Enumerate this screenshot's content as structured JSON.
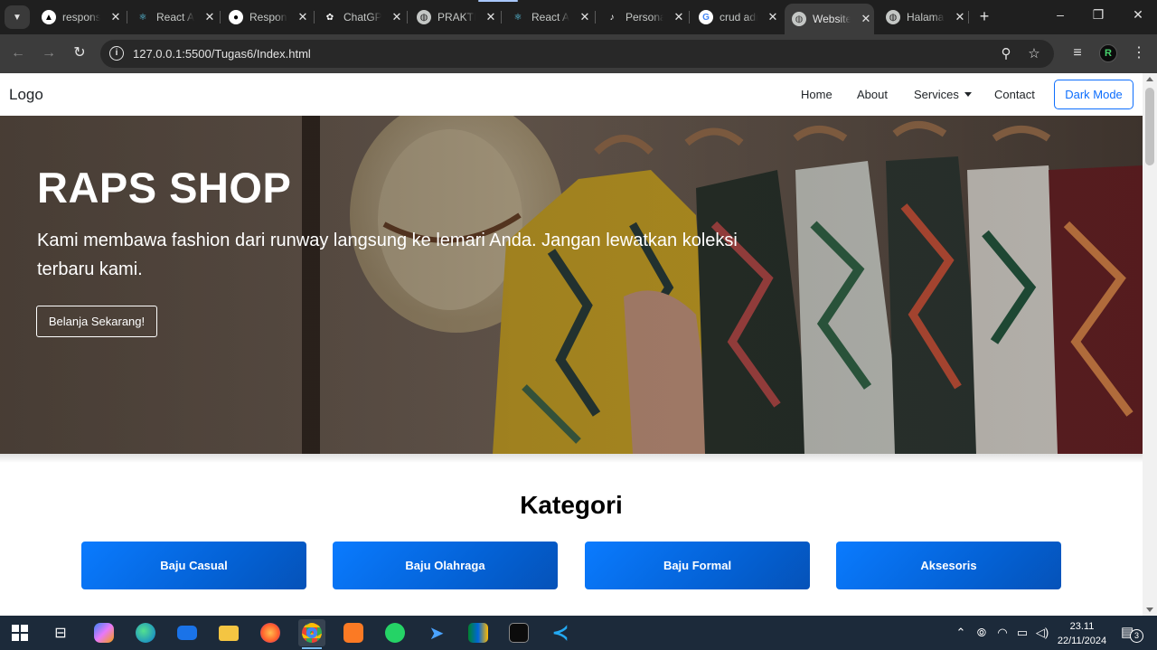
{
  "browser": {
    "tabs": [
      {
        "title": "responsive",
        "favicon": "vercel-icon",
        "favicon_color": "#000000"
      },
      {
        "title": "React App",
        "favicon": "react-icon",
        "favicon_color": "#61dafb"
      },
      {
        "title": "Responsive",
        "favicon": "github-icon",
        "favicon_color": "#ffffff"
      },
      {
        "title": "ChatGPT",
        "favicon": "chatgpt-icon",
        "favicon_color": "#ffffff"
      },
      {
        "title": "PRAKTIKUM",
        "favicon": "globe-icon",
        "favicon_color": "#c4c7c5"
      },
      {
        "title": "React App",
        "favicon": "react-icon",
        "favicon_color": "#61dafb"
      },
      {
        "title": "Personal",
        "favicon": "tiktok-icon",
        "favicon_color": "#ffffff"
      },
      {
        "title": "crud admin",
        "favicon": "google-icon",
        "favicon_color": "#4285f4"
      },
      {
        "title": "Website",
        "favicon": "globe-icon",
        "favicon_color": "#c4c7c5",
        "active": true
      },
      {
        "title": "Halaman",
        "favicon": "globe-icon",
        "favicon_color": "#c4c7c5"
      }
    ],
    "close_glyph": "✕",
    "new_tab_glyph": "+",
    "url": "127.0.0.1:5500/Tugas6/Index.html",
    "profile_initial": "R"
  },
  "navbar": {
    "logo": "Logo",
    "links": {
      "home": "Home",
      "about": "About",
      "services": "Services",
      "contact": "Contact"
    },
    "dark_mode": "Dark Mode"
  },
  "hero": {
    "title": "RAPS SHOP",
    "text": "Kami membawa fashion dari runway langsung ke lemari Anda. Jangan lewatkan koleksi terbaru kami.",
    "cta": "Belanja Sekarang!"
  },
  "kategori": {
    "title": "Kategori",
    "items": [
      "Baju Casual",
      "Baju Olahraga",
      "Baju Formal",
      "Aksesoris"
    ]
  },
  "taskbar": {
    "time": "23.11",
    "date": "22/11/2024",
    "notification_count": "3"
  },
  "colors": {
    "primary": "#0d6efd",
    "category_button": "#0466e0",
    "taskbar": "#1c2a3a"
  }
}
